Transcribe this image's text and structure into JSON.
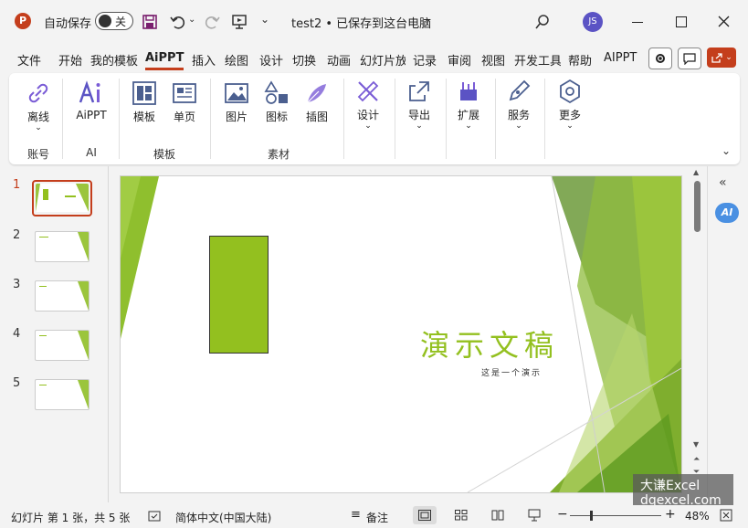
{
  "titlebar": {
    "autosave_label": "自动保存",
    "autosave_state": "关",
    "doc_title": "test2 • 已保存到这台电脑",
    "user_initials": "JS"
  },
  "menu": {
    "tabs": [
      "文件",
      "开始",
      "我的模板",
      "AiPPT",
      "插入",
      "绘图",
      "设计",
      "切换",
      "动画",
      "幻灯片放",
      "记录",
      "审阅",
      "视图",
      "开发工具",
      "帮助",
      "AIPPT"
    ],
    "active_index": 3
  },
  "ribbon": {
    "items": [
      {
        "label": "离线",
        "icon": "link-icon"
      },
      {
        "label": "AiPPT",
        "icon": "ai-icon"
      },
      {
        "label": "模板",
        "icon": "template-icon"
      },
      {
        "label": "单页",
        "icon": "single-page-icon"
      },
      {
        "label": "图片",
        "icon": "picture-icon"
      },
      {
        "label": "图标",
        "icon": "shapes-icon"
      },
      {
        "label": "插图",
        "icon": "illustration-icon"
      },
      {
        "label": "设计",
        "icon": "design-icon"
      },
      {
        "label": "导出",
        "icon": "export-icon"
      },
      {
        "label": "扩展",
        "icon": "extension-icon"
      },
      {
        "label": "服务",
        "icon": "pen-icon"
      },
      {
        "label": "更多",
        "icon": "hexagon-icon"
      }
    ],
    "groups": [
      "账号",
      "AI",
      "模板",
      "素材"
    ]
  },
  "slides": {
    "numbers": [
      "1",
      "2",
      "3",
      "4",
      "5"
    ],
    "selected": 1
  },
  "slide": {
    "title": "演示文稿",
    "subtitle": "这是一个演示"
  },
  "colors": {
    "accent": "#c43e1c",
    "green_light": "#9bc53d",
    "green_dark": "#5e8f2f",
    "rect_fill": "#93c01f"
  },
  "status": {
    "slide_info": "幻灯片 第 1 张，共 5 张",
    "language": "简体中文(中国大陆)",
    "notes": "备注",
    "zoom": "48%"
  },
  "watermark": {
    "line1": "大谦Excel",
    "line2": "dqexcel.com"
  }
}
